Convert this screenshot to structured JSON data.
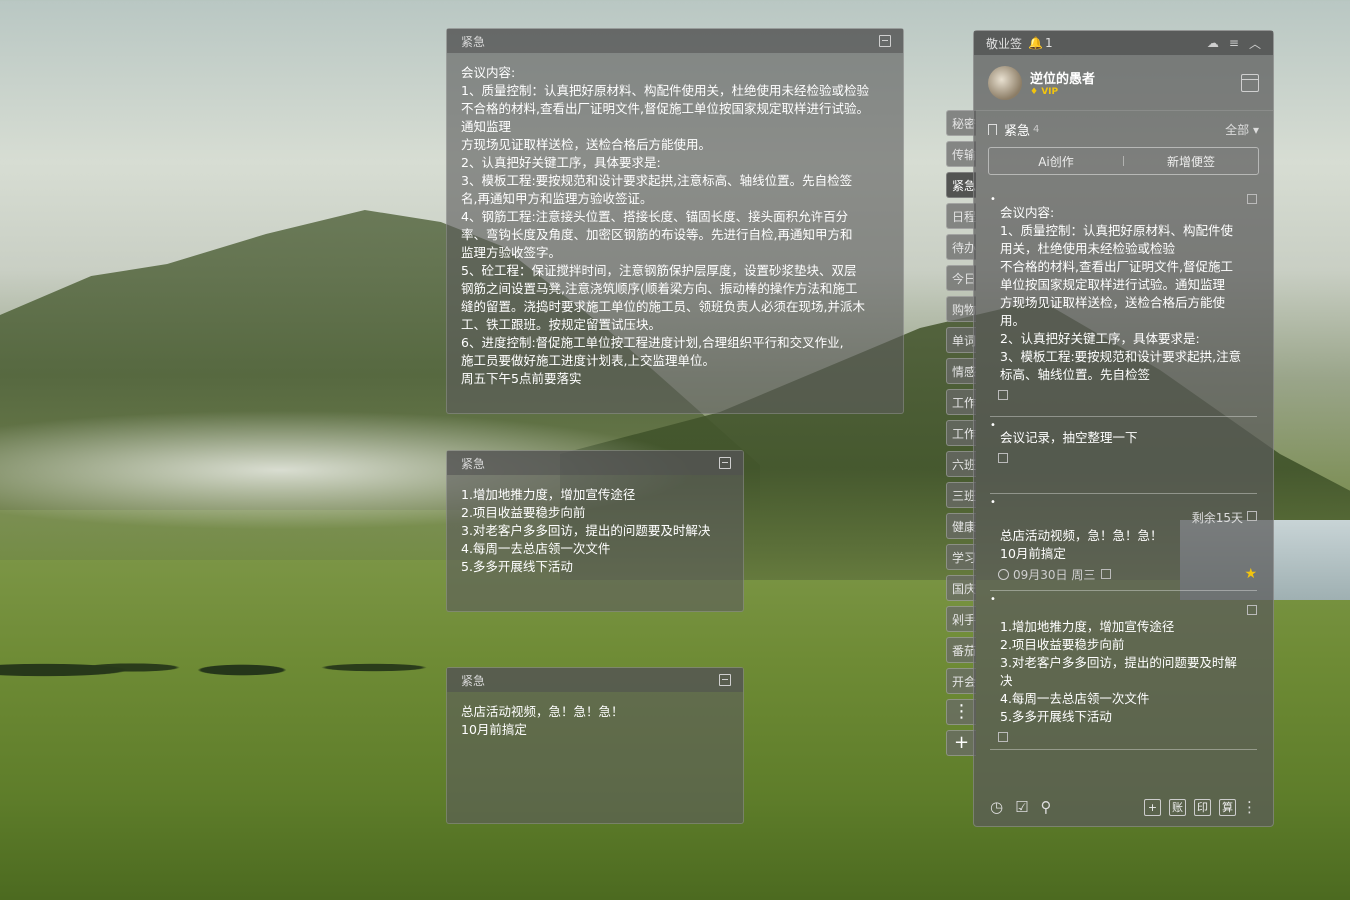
{
  "notes": [
    {
      "category": "紧急",
      "lines": [
        "会议内容:",
        "1、质量控制：认真把好原材料、构配件使用关，杜绝使用未经检验或检验",
        "不合格的材料,查看出厂证明文件,督促施工单位按国家规定取样进行试验。",
        "通知监理",
        "方现场见证取样送检，送检合格后方能使用。",
        "2、认真把好关键工序，具体要求是:",
        "3、模板工程:要按规范和设计要求起拱,注意标高、轴线位置。先自检签",
        "名,再通知甲方和监理方验收签证。",
        "4、钢筋工程:注意接头位置、搭接长度、锚固长度、接头面积允许百分",
        "率、弯钩长度及角度、加密区钢筋的布设等。先进行自检,再通知甲方和",
        "监理方验收签字。",
        "5、砼工程：保证搅拌时间，注意钢筋保护层厚度，设置砂浆垫块、双层",
        "钢筋之间设置马凳,注意浇筑顺序(顺着梁方向、振动棒的操作方法和施工",
        "缝的留置。浇捣时要求施工单位的施工员、领班负责人必须在现场,并派木",
        "工、铁工跟班。按规定留置试压块。",
        "6、进度控制:督促施工单位按工程进度计划,合理组织平行和交叉作业,",
        "施工员要做好施工进度计划表,上交监理单位。",
        "周五下午5点前要落实"
      ]
    },
    {
      "category": "紧急",
      "lines": [
        "1.增加地推力度，增加宣传途径",
        "2.项目收益要稳步向前",
        "3.对老客户多多回访，提出的问题要及时解决",
        "4.每周一去总店领一次文件",
        "5.多多开展线下活动"
      ]
    },
    {
      "category": "紧急",
      "lines": [
        "总店活动视频，急！急！急！",
        "10月前搞定"
      ]
    }
  ],
  "side_tabs": [
    "秘密",
    "传输",
    "紧急",
    "日程",
    "待办",
    "今日",
    "购物",
    "单词",
    "情感",
    "工作",
    "工作",
    "六班",
    "三班",
    "健康",
    "学习",
    "国庆",
    "剁手",
    "番茄",
    "开会"
  ],
  "side_tab_more": "⋮",
  "side_tab_add": "+",
  "panel": {
    "app_name": "敬业签",
    "notify_count": "1",
    "user_name": "逆位的愚者",
    "vip_label": "VIP",
    "category_name": "紧急",
    "category_count": "4",
    "filter_label": "全部",
    "ai_button": "Ai创作",
    "new_button": "新增便签",
    "items": [
      {
        "lines": [
          "会议内容:",
          "1、质量控制：认真把好原材料、构配件使",
          "用关，杜绝使用未经检验或检验",
          "不合格的材料,查看出厂证明文件,督促施工",
          "单位按国家规定取样进行试验。通知监理",
          "方现场见证取样送检，送检合格后方能使",
          "用。",
          "2、认真把好关键工序，具体要求是:",
          "3、模板工程:要按规范和设计要求起拱,注意",
          "标高、轴线位置。先自检签"
        ]
      },
      {
        "lines": [
          "会议记录，抽空整理一下"
        ]
      },
      {
        "remain": "剩余15天",
        "lines": [
          "总店活动视频，急！急！急！",
          "10月前搞定"
        ],
        "date": "09月30日 周三"
      },
      {
        "lines": [
          "1.增加地推力度，增加宣传途径",
          "2.项目收益要稳步向前",
          "3.对老客户多多回访，提出的问题要及时解",
          "决",
          "4.每周一去总店领一次文件",
          "5.多多开展线下活动"
        ]
      }
    ],
    "bottom_boxes": [
      "+",
      "账",
      "印",
      "算"
    ]
  },
  "colors": {
    "vip": "#f1c40f",
    "star": "#f1c40f"
  },
  "icons": [
    "exit-icon",
    "cloud-icon",
    "menu-icon",
    "collapse-icon",
    "bell-icon",
    "calendar-icon",
    "bookmark-icon",
    "clock-icon",
    "document-icon",
    "star-icon",
    "search-icon",
    "alarm-icon",
    "checkbox-icon"
  ]
}
